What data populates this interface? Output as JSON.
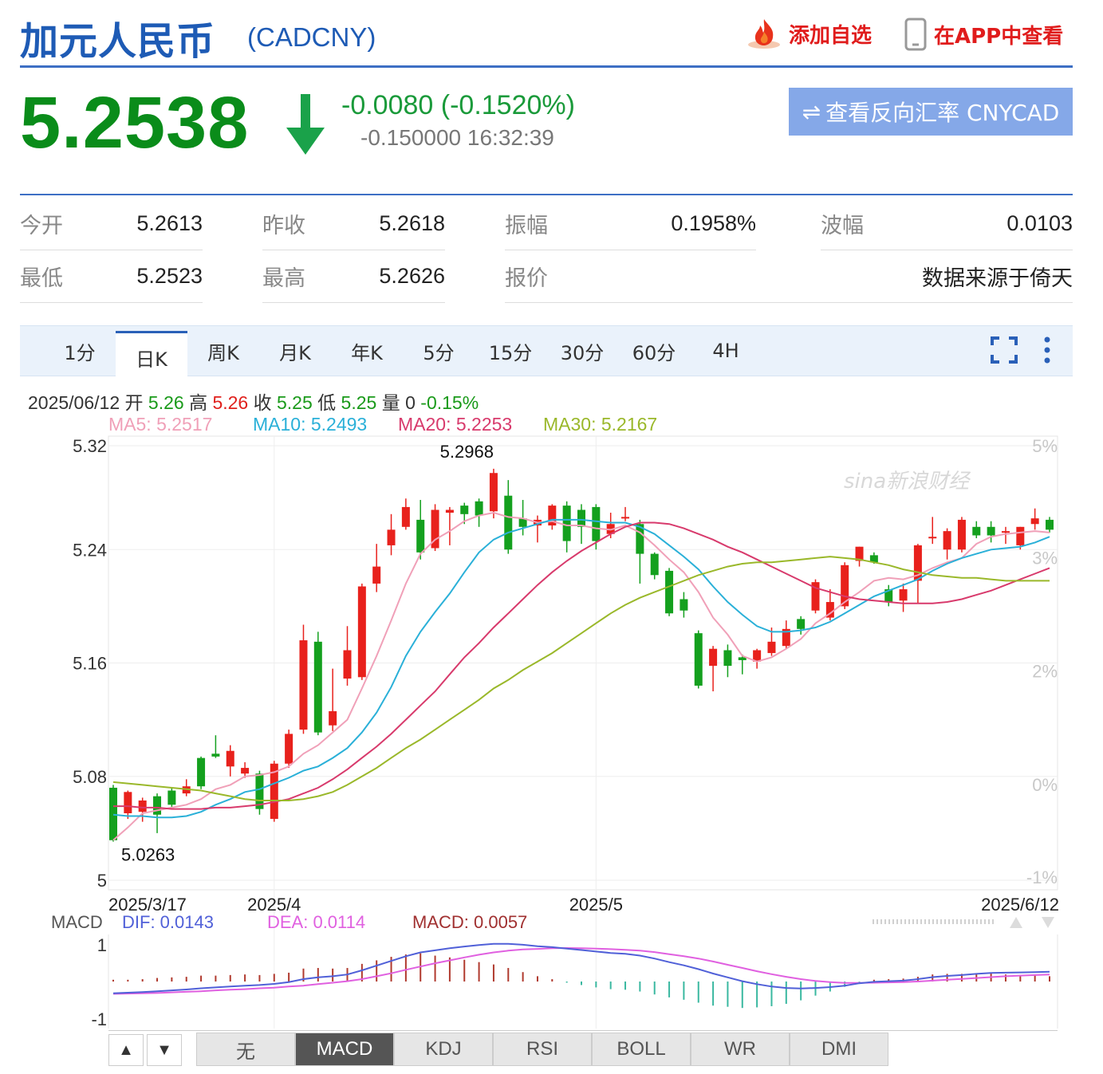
{
  "header": {
    "name": "加元人民币",
    "code": "(CADCNY)",
    "add_fav": "添加自选",
    "view_app": "在APP中查看"
  },
  "quote": {
    "price": "5.2538",
    "change": "-0.0080 (-0.1520%)",
    "sub": "-0.150000 16:32:39",
    "reverse_btn": "查看反向汇率 CNYCAD"
  },
  "stats": [
    {
      "label": "今开",
      "value": "5.2613"
    },
    {
      "label": "昨收",
      "value": "5.2618"
    },
    {
      "label": "振幅",
      "value": "0.1958%"
    },
    {
      "label": "波幅",
      "value": "0.0103"
    },
    {
      "label": "最低",
      "value": "5.2523"
    },
    {
      "label": "最高",
      "value": "5.2626"
    },
    {
      "label": "报价",
      "value": ""
    },
    {
      "label": "",
      "value": "数据来源于倚天"
    }
  ],
  "tabs": [
    "1分",
    "日K",
    "周K",
    "月K",
    "年K",
    "5分",
    "15分",
    "30分",
    "60分",
    "4H"
  ],
  "active_tab": "日K",
  "info": {
    "date": "2025/06/12",
    "open_lbl": "开",
    "open": "5.26",
    "high_lbl": "高",
    "high": "5.26",
    "close_lbl": "收",
    "close": "5.25",
    "low_lbl": "低",
    "low": "5.25",
    "vol_lbl": "量",
    "vol": "0",
    "pct": "-0.15%"
  },
  "ma_labels": [
    {
      "text": "MA5: 5.2517",
      "color": "#f0a0b8"
    },
    {
      "text": "MA10: 5.2493",
      "color": "#2ab0d8"
    },
    {
      "text": "MA20: 5.2253",
      "color": "#d83a6c"
    },
    {
      "text": "MA30: 5.2167",
      "color": "#9ab82a"
    }
  ],
  "colors": {
    "up": "#e8211c",
    "down": "#14a01e",
    "accent": "#1e5bb5"
  },
  "chart_data": {
    "type": "candlestick",
    "ylim": [
      5.0,
      5.32
    ],
    "y_ticks": [
      "5.32",
      "5.24",
      "5.16",
      "5.08",
      "5"
    ],
    "pct_ticks": [
      "5%",
      "3%",
      "2%",
      "0%",
      "-1%"
    ],
    "x_labels": [
      {
        "label": "2025/3/17",
        "index": 0
      },
      {
        "label": "2025/4",
        "index": 11
      },
      {
        "label": "2025/5",
        "index": 33
      },
      {
        "label": "2025/6/12",
        "index": 63
      }
    ],
    "max_label": "5.2968",
    "min_label": "5.0263",
    "watermark": "sina新浪财经",
    "candles": [
      {
        "o": 5.072,
        "c": 5.035,
        "h": 5.074,
        "l": 5.034
      },
      {
        "o": 5.054,
        "c": 5.069,
        "h": 5.07,
        "l": 5.05
      },
      {
        "o": 5.055,
        "c": 5.063,
        "h": 5.065,
        "l": 5.048
      },
      {
        "o": 5.066,
        "c": 5.053,
        "h": 5.068,
        "l": 5.04
      },
      {
        "o": 5.07,
        "c": 5.06,
        "h": 5.072,
        "l": 5.058
      },
      {
        "o": 5.068,
        "c": 5.073,
        "h": 5.078,
        "l": 5.066
      },
      {
        "o": 5.093,
        "c": 5.073,
        "h": 5.094,
        "l": 5.071
      },
      {
        "o": 5.096,
        "c": 5.094,
        "h": 5.109,
        "l": 5.093
      },
      {
        "o": 5.087,
        "c": 5.098,
        "h": 5.102,
        "l": 5.08
      },
      {
        "o": 5.082,
        "c": 5.086,
        "h": 5.09,
        "l": 5.079
      },
      {
        "o": 5.082,
        "c": 5.057,
        "h": 5.084,
        "l": 5.053
      },
      {
        "o": 5.05,
        "c": 5.089,
        "h": 5.091,
        "l": 5.048
      },
      {
        "o": 5.089,
        "c": 5.11,
        "h": 5.113,
        "l": 5.086
      },
      {
        "o": 5.113,
        "c": 5.176,
        "h": 5.187,
        "l": 5.11
      },
      {
        "o": 5.175,
        "c": 5.111,
        "h": 5.182,
        "l": 5.109
      },
      {
        "o": 5.116,
        "c": 5.126,
        "h": 5.156,
        "l": 5.112
      },
      {
        "o": 5.149,
        "c": 5.169,
        "h": 5.186,
        "l": 5.144
      },
      {
        "o": 5.15,
        "c": 5.214,
        "h": 5.216,
        "l": 5.148
      },
      {
        "o": 5.216,
        "c": 5.228,
        "h": 5.244,
        "l": 5.21
      },
      {
        "o": 5.243,
        "c": 5.254,
        "h": 5.265,
        "l": 5.236
      },
      {
        "o": 5.256,
        "c": 5.27,
        "h": 5.276,
        "l": 5.254
      },
      {
        "o": 5.261,
        "c": 5.238,
        "h": 5.275,
        "l": 5.233
      },
      {
        "o": 5.241,
        "c": 5.268,
        "h": 5.272,
        "l": 5.239
      },
      {
        "o": 5.266,
        "c": 5.268,
        "h": 5.27,
        "l": 5.243
      },
      {
        "o": 5.271,
        "c": 5.265,
        "h": 5.273,
        "l": 5.258
      },
      {
        "o": 5.274,
        "c": 5.264,
        "h": 5.276,
        "l": 5.256
      },
      {
        "o": 5.267,
        "c": 5.294,
        "h": 5.297,
        "l": 5.262
      },
      {
        "o": 5.278,
        "c": 5.24,
        "h": 5.289,
        "l": 5.237
      },
      {
        "o": 5.262,
        "c": 5.256,
        "h": 5.275,
        "l": 5.25
      },
      {
        "o": 5.257,
        "c": 5.261,
        "h": 5.264,
        "l": 5.245
      },
      {
        "o": 5.257,
        "c": 5.271,
        "h": 5.272,
        "l": 5.254
      },
      {
        "o": 5.271,
        "c": 5.246,
        "h": 5.274,
        "l": 5.238
      },
      {
        "o": 5.268,
        "c": 5.256,
        "h": 5.272,
        "l": 5.244
      },
      {
        "o": 5.27,
        "c": 5.246,
        "h": 5.272,
        "l": 5.24
      },
      {
        "o": 5.251,
        "c": 5.258,
        "h": 5.266,
        "l": 5.248
      },
      {
        "o": 5.262,
        "c": 5.263,
        "h": 5.27,
        "l": 5.26
      },
      {
        "o": 5.258,
        "c": 5.237,
        "h": 5.261,
        "l": 5.216
      },
      {
        "o": 5.237,
        "c": 5.222,
        "h": 5.238,
        "l": 5.219
      },
      {
        "o": 5.225,
        "c": 5.195,
        "h": 5.227,
        "l": 5.193
      },
      {
        "o": 5.205,
        "c": 5.197,
        "h": 5.21,
        "l": 5.192
      },
      {
        "o": 5.181,
        "c": 5.144,
        "h": 5.183,
        "l": 5.142
      },
      {
        "o": 5.158,
        "c": 5.17,
        "h": 5.172,
        "l": 5.14
      },
      {
        "o": 5.169,
        "c": 5.158,
        "h": 5.173,
        "l": 5.15
      },
      {
        "o": 5.164,
        "c": 5.162,
        "h": 5.166,
        "l": 5.152
      },
      {
        "o": 5.161,
        "c": 5.169,
        "h": 5.17,
        "l": 5.156
      },
      {
        "o": 5.167,
        "c": 5.175,
        "h": 5.185,
        "l": 5.165
      },
      {
        "o": 5.172,
        "c": 5.184,
        "h": 5.19,
        "l": 5.17
      },
      {
        "o": 5.191,
        "c": 5.184,
        "h": 5.193,
        "l": 5.18
      },
      {
        "o": 5.197,
        "c": 5.217,
        "h": 5.219,
        "l": 5.195
      },
      {
        "o": 5.192,
        "c": 5.203,
        "h": 5.212,
        "l": 5.19
      },
      {
        "o": 5.2,
        "c": 5.229,
        "h": 5.231,
        "l": 5.198
      },
      {
        "o": 5.232,
        "c": 5.242,
        "h": 5.242,
        "l": 5.228
      },
      {
        "o": 5.236,
        "c": 5.231,
        "h": 5.238,
        "l": 5.23
      },
      {
        "o": 5.212,
        "c": 5.203,
        "h": 5.215,
        "l": 5.2
      },
      {
        "o": 5.204,
        "c": 5.212,
        "h": 5.216,
        "l": 5.196
      },
      {
        "o": 5.218,
        "c": 5.243,
        "h": 5.244,
        "l": 5.202
      },
      {
        "o": 5.249,
        "c": 5.249,
        "h": 5.263,
        "l": 5.244
      },
      {
        "o": 5.24,
        "c": 5.253,
        "h": 5.255,
        "l": 5.233
      },
      {
        "o": 5.24,
        "c": 5.261,
        "h": 5.263,
        "l": 5.238
      },
      {
        "o": 5.256,
        "c": 5.25,
        "h": 5.26,
        "l": 5.248
      },
      {
        "o": 5.256,
        "c": 5.25,
        "h": 5.26,
        "l": 5.245
      },
      {
        "o": 5.252,
        "c": 5.253,
        "h": 5.256,
        "l": 5.244
      },
      {
        "o": 5.243,
        "c": 5.256,
        "h": 5.256,
        "l": 5.24
      },
      {
        "o": 5.258,
        "c": 5.262,
        "h": 5.269,
        "l": 5.254
      },
      {
        "o": 5.261,
        "c": 5.254,
        "h": 5.263,
        "l": 5.252
      }
    ],
    "ma_series": [
      {
        "name": "MA5",
        "color": "#f0a0b8",
        "values": [
          5.035,
          5.044,
          5.054,
          5.056,
          5.058,
          5.06,
          5.064,
          5.071,
          5.074,
          5.08,
          5.081,
          5.083,
          5.087,
          5.096,
          5.102,
          5.111,
          5.12,
          5.142,
          5.165,
          5.19,
          5.216,
          5.237,
          5.247,
          5.253,
          5.26,
          5.264,
          5.266,
          5.263,
          5.262,
          5.259,
          5.26,
          5.257,
          5.257,
          5.255,
          5.254,
          5.257,
          5.252,
          5.243,
          5.233,
          5.224,
          5.21,
          5.192,
          5.18,
          5.165,
          5.161,
          5.164,
          5.17,
          5.177,
          5.188,
          5.195,
          5.203,
          5.21,
          5.218,
          5.22,
          5.219,
          5.222,
          5.227,
          5.231,
          5.234,
          5.244,
          5.249,
          5.251,
          5.252,
          5.253,
          5.252
        ]
      },
      {
        "name": "MA10",
        "color": "#2ab0d8",
        "values": [
          5.053,
          5.052,
          5.052,
          5.051,
          5.051,
          5.052,
          5.055,
          5.06,
          5.064,
          5.069,
          5.071,
          5.075,
          5.079,
          5.084,
          5.087,
          5.093,
          5.1,
          5.111,
          5.125,
          5.143,
          5.165,
          5.182,
          5.196,
          5.209,
          5.224,
          5.238,
          5.247,
          5.252,
          5.255,
          5.258,
          5.261,
          5.261,
          5.261,
          5.26,
          5.259,
          5.259,
          5.256,
          5.251,
          5.243,
          5.235,
          5.226,
          5.214,
          5.203,
          5.194,
          5.186,
          5.182,
          5.182,
          5.183,
          5.185,
          5.189,
          5.195,
          5.201,
          5.207,
          5.211,
          5.215,
          5.219,
          5.225,
          5.23,
          5.234,
          5.237,
          5.24,
          5.241,
          5.242,
          5.245,
          5.249
        ]
      },
      {
        "name": "MA20",
        "color": "#d83a6c",
        "values": [
          5.059,
          5.059,
          5.058,
          5.058,
          5.057,
          5.057,
          5.057,
          5.058,
          5.058,
          5.059,
          5.06,
          5.062,
          5.064,
          5.068,
          5.072,
          5.078,
          5.085,
          5.093,
          5.101,
          5.11,
          5.12,
          5.13,
          5.14,
          5.152,
          5.164,
          5.174,
          5.185,
          5.195,
          5.205,
          5.215,
          5.224,
          5.232,
          5.239,
          5.245,
          5.251,
          5.256,
          5.259,
          5.259,
          5.258,
          5.255,
          5.251,
          5.247,
          5.242,
          5.238,
          5.233,
          5.228,
          5.223,
          5.218,
          5.213,
          5.21,
          5.207,
          5.205,
          5.204,
          5.203,
          5.202,
          5.202,
          5.202,
          5.203,
          5.205,
          5.208,
          5.211,
          5.215,
          5.219,
          5.223,
          5.227
        ]
      },
      {
        "name": "MA30",
        "color": "#9ab82a",
        "values": [
          5.076,
          5.075,
          5.074,
          5.073,
          5.072,
          5.071,
          5.07,
          5.068,
          5.066,
          5.064,
          5.063,
          5.063,
          5.063,
          5.064,
          5.066,
          5.069,
          5.074,
          5.08,
          5.086,
          5.093,
          5.1,
          5.106,
          5.113,
          5.12,
          5.127,
          5.134,
          5.142,
          5.148,
          5.155,
          5.161,
          5.167,
          5.174,
          5.181,
          5.188,
          5.195,
          5.201,
          5.206,
          5.21,
          5.214,
          5.218,
          5.222,
          5.225,
          5.228,
          5.23,
          5.231,
          5.231,
          5.232,
          5.233,
          5.234,
          5.235,
          5.234,
          5.233,
          5.231,
          5.229,
          5.226,
          5.224,
          5.222,
          5.221,
          5.22,
          5.22,
          5.219,
          5.218,
          5.218,
          5.218,
          5.218
        ]
      }
    ],
    "macd": {
      "label": "MACD",
      "dif_label": "DIF: 0.0143",
      "dea_label": "DEA: 0.0114",
      "macd_label": "MACD: 0.0057",
      "y_ticks": [
        "1",
        "-1"
      ],
      "ylim": [
        -1.6,
        1.6
      ],
      "dif": [
        -0.4,
        -0.38,
        -0.36,
        -0.33,
        -0.3,
        -0.27,
        -0.23,
        -0.2,
        -0.17,
        -0.14,
        -0.12,
        -0.08,
        -0.02,
        0.08,
        0.14,
        0.18,
        0.24,
        0.38,
        0.54,
        0.7,
        0.86,
        0.99,
        1.06,
        1.13,
        1.19,
        1.24,
        1.28,
        1.28,
        1.25,
        1.2,
        1.17,
        1.12,
        1.07,
        1.02,
        0.97,
        0.94,
        0.88,
        0.78,
        0.66,
        0.55,
        0.42,
        0.27,
        0.14,
        0.01,
        -0.09,
        -0.17,
        -0.22,
        -0.24,
        -0.22,
        -0.19,
        -0.14,
        -0.06,
        -0.01,
        0.01,
        0.03,
        0.08,
        0.15,
        0.19,
        0.22,
        0.26,
        0.29,
        0.3,
        0.31,
        0.32,
        0.33
      ],
      "dea": [
        -0.42,
        -0.41,
        -0.4,
        -0.39,
        -0.37,
        -0.35,
        -0.33,
        -0.3,
        -0.28,
        -0.26,
        -0.23,
        -0.21,
        -0.17,
        -0.14,
        -0.09,
        -0.04,
        0.01,
        0.08,
        0.18,
        0.28,
        0.4,
        0.51,
        0.62,
        0.72,
        0.82,
        0.91,
        0.99,
        1.05,
        1.09,
        1.11,
        1.13,
        1.14,
        1.13,
        1.12,
        1.1,
        1.08,
        1.05,
        1.0,
        0.93,
        0.86,
        0.78,
        0.68,
        0.57,
        0.46,
        0.35,
        0.25,
        0.16,
        0.08,
        0.02,
        -0.02,
        -0.05,
        -0.05,
        -0.04,
        -0.03,
        -0.02,
        0.0,
        0.03,
        0.06,
        0.09,
        0.12,
        0.15,
        0.18,
        0.2,
        0.22,
        0.24
      ],
      "hist": [
        0.06,
        0.06,
        0.08,
        0.12,
        0.14,
        0.16,
        0.2,
        0.2,
        0.22,
        0.24,
        0.22,
        0.26,
        0.3,
        0.44,
        0.46,
        0.44,
        0.46,
        0.6,
        0.72,
        0.84,
        0.92,
        0.96,
        0.88,
        0.82,
        0.74,
        0.66,
        0.58,
        0.46,
        0.32,
        0.18,
        0.08,
        -0.04,
        -0.12,
        -0.2,
        -0.26,
        -0.28,
        -0.34,
        -0.44,
        -0.54,
        -0.62,
        -0.72,
        -0.82,
        -0.86,
        -0.9,
        -0.88,
        -0.84,
        -0.76,
        -0.64,
        -0.48,
        -0.34,
        -0.18,
        -0.02,
        0.06,
        0.08,
        0.1,
        0.16,
        0.24,
        0.26,
        0.26,
        0.28,
        0.28,
        0.24,
        0.22,
        0.2,
        0.18
      ]
    }
  },
  "indicator_tabs": [
    "无",
    "MACD",
    "KDJ",
    "RSI",
    "BOLL",
    "WR",
    "DMI"
  ],
  "active_indicator": "MACD",
  "up_arrow": "▲",
  "down_arrow": "▼"
}
